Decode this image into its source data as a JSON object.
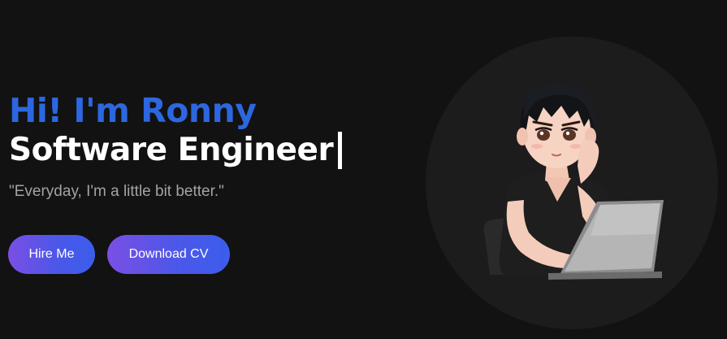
{
  "hero": {
    "greeting": "Hi! I'm Ronny",
    "role": "Software Engineer",
    "tagline": "\"Everyday, I'm a little bit better.\""
  },
  "buttons": {
    "hire_label": "Hire Me",
    "cv_label": "Download CV"
  },
  "colors": {
    "background": "#121212",
    "accent_blue": "#2d67e0",
    "button_gradient_start": "#7a4fe4",
    "button_gradient_end": "#3b5ded",
    "circle": "#1c1c1c"
  },
  "avatar": {
    "icon": "anime-developer-illustration"
  }
}
